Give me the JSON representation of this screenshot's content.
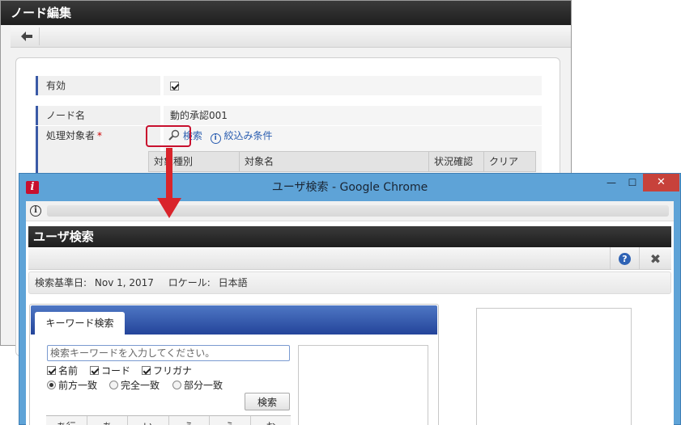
{
  "background_window": {
    "title": "ノード編集",
    "rows": {
      "enabled_label": "有効",
      "enabled_checked": true,
      "node_name_label": "ノード名",
      "node_name_value": "動的承認001",
      "processor_label": "処理対象者",
      "required_mark": "*",
      "search_link": "検索",
      "filter_link": "絞込み条件"
    },
    "table_headers": [
      "対象種別",
      "対象名",
      "状況確認",
      "クリア"
    ]
  },
  "chrome_window": {
    "title": "ユーザ検索 - Google Chrome",
    "controls": {
      "minimize": "—",
      "maximize": "☐",
      "close": "✕"
    },
    "popup_title": "ユーザ検索",
    "info_strip": {
      "base_date_label": "検索基準日:",
      "base_date_value": "Nov 1, 2017",
      "locale_label": "ロケール:",
      "locale_value": "日本語"
    },
    "tabs": {
      "keyword": "キーワード検索"
    },
    "search": {
      "placeholder": "検索キーワードを入力してください。",
      "checkbox_name": "名前",
      "checkbox_code": "コード",
      "checkbox_kana": "フリガナ",
      "radio_prefix": "前方一致",
      "radio_exact": "完全一致",
      "radio_partial": "部分一致",
      "button": "検索"
    },
    "kana_row": [
      "あ行",
      "あ",
      "い",
      "う",
      "え",
      "お"
    ]
  }
}
